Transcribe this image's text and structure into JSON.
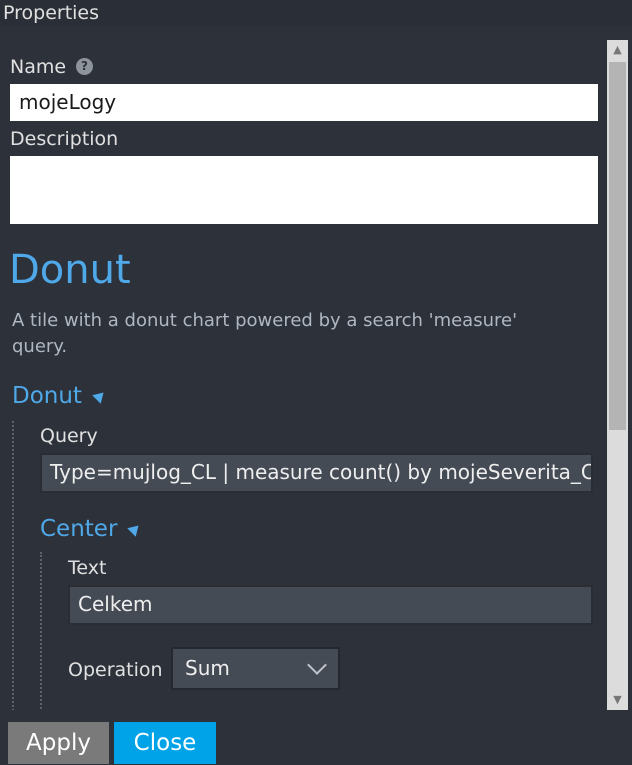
{
  "panel": {
    "title": "Properties"
  },
  "fields": {
    "name_label": "Name",
    "name_help_icon": "?",
    "name_value": "mojeLogy",
    "description_label": "Description",
    "description_value": ""
  },
  "section": {
    "title": "Donut",
    "description": "A tile with a donut chart powered by a search 'measure' query."
  },
  "donut_group": {
    "header": "Donut",
    "query_label": "Query",
    "query_value": "Type=mujlog_CL | measure count() by mojeSeverita_CL"
  },
  "center_group": {
    "header": "Center",
    "text_label": "Text",
    "text_value": "Celkem",
    "operation_label": "Operation",
    "operation_value": "Sum"
  },
  "footer": {
    "apply_label": "Apply",
    "close_label": "Close"
  },
  "colors": {
    "accent": "#4fa8e8",
    "close_button": "#00a2e8",
    "apply_button": "#7a7a7a",
    "background": "#2d313a"
  }
}
